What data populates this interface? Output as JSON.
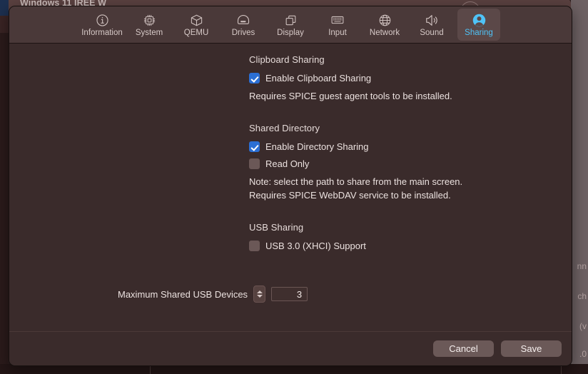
{
  "background": {
    "window_title": "Windows 11 IREE W",
    "right_fragments": [
      "nn",
      "ch",
      "(v",
      ".0"
    ]
  },
  "dialog": {
    "toolbar": {
      "tabs": [
        {
          "label": "Information",
          "icon": "info-circle-icon",
          "selected": false
        },
        {
          "label": "System",
          "icon": "cpu-chip-icon",
          "selected": false
        },
        {
          "label": "QEMU",
          "icon": "box-cube-icon",
          "selected": false
        },
        {
          "label": "Drives",
          "icon": "hard-drive-icon",
          "selected": false
        },
        {
          "label": "Display",
          "icon": "windows-stack-icon",
          "selected": false
        },
        {
          "label": "Input",
          "icon": "keyboard-icon",
          "selected": false
        },
        {
          "label": "Network",
          "icon": "globe-icon",
          "selected": false
        },
        {
          "label": "Sound",
          "icon": "speaker-icon",
          "selected": false
        },
        {
          "label": "Sharing",
          "icon": "person-circle-icon",
          "selected": true
        }
      ],
      "selected_tab": "Sharing",
      "accent_color": "#4fc3f7"
    },
    "sections": {
      "clipboard": {
        "title": "Clipboard Sharing",
        "enable_label": "Enable Clipboard Sharing",
        "enable_checked": true,
        "note": "Requires SPICE guest agent tools to be installed."
      },
      "shared_directory": {
        "title": "Shared Directory",
        "enable_label": "Enable Directory Sharing",
        "enable_checked": true,
        "read_only_label": "Read Only",
        "read_only_checked": false,
        "note_line1": "Note: select the path to share from the main screen.",
        "note_line2": "Requires SPICE WebDAV service to be installed."
      },
      "usb": {
        "title": "USB Sharing",
        "xhci_label": "USB 3.0 (XHCI) Support",
        "xhci_checked": false,
        "max_devices_label": "Maximum Shared USB Devices",
        "max_devices_value": "3"
      }
    },
    "footer": {
      "cancel_label": "Cancel",
      "save_label": "Save"
    },
    "colors": {
      "checkbox_on": "#2b6fd4",
      "checkbox_off": "#6b5857",
      "dialog_bg": "#3a2b2b",
      "toolbar_bg": "#4a3939"
    }
  }
}
